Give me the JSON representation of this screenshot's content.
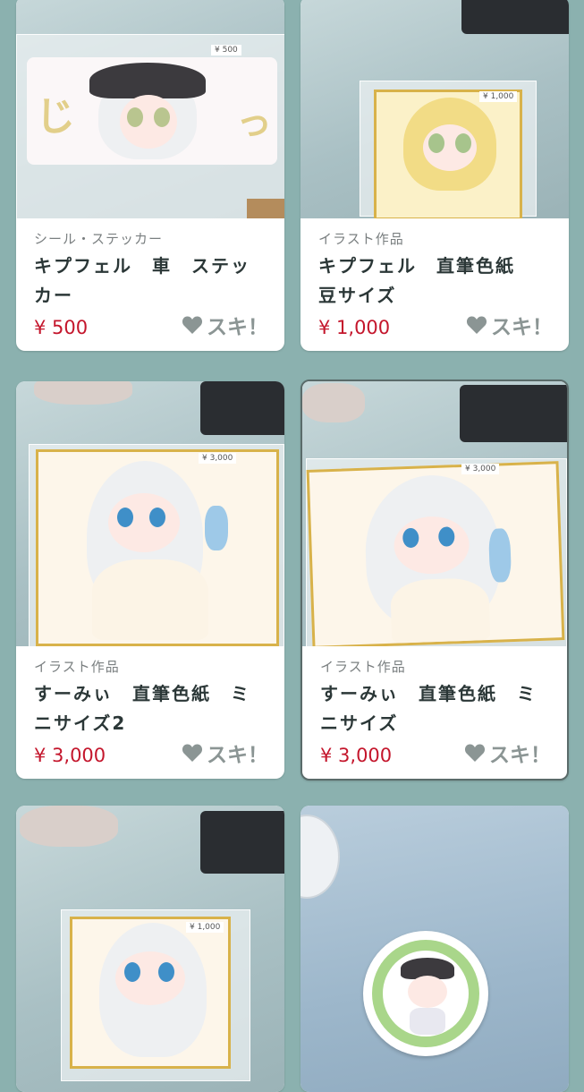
{
  "like_label": "スキ！",
  "colors": {
    "background": "#8bb1af",
    "price": "#c4162c",
    "accent": "#2b3737"
  },
  "products": [
    {
      "category": "シール・ステッカー",
      "title": "キプフェル　車　ステッカー",
      "price": "¥ 500",
      "tag": "¥ 500"
    },
    {
      "category": "イラスト作品",
      "title": "キプフェル　直筆色紙　豆サイズ",
      "price": "¥ 1,000",
      "tag": "¥ 1,000"
    },
    {
      "category": "イラスト作品",
      "title": "すーみぃ　直筆色紙　ミニサイズ2",
      "price": "¥ 3,000",
      "tag": "¥ 3,000"
    },
    {
      "category": "イラスト作品",
      "title": "すーみぃ　直筆色紙　ミニサイズ",
      "price": "¥ 3,000",
      "tag": "¥ 3,000"
    },
    {
      "category": "",
      "title": "",
      "price": "",
      "tag": "¥ 1,000"
    },
    {
      "category": "",
      "title": "",
      "price": "",
      "tag": ""
    }
  ]
}
